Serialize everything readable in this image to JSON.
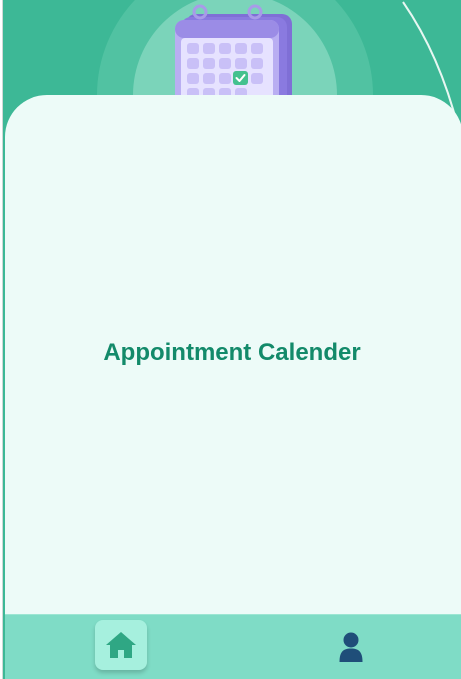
{
  "screen": {
    "title": "Appointment Calender"
  },
  "header": {
    "illustration": "calendar-illustration"
  },
  "bottom_nav": {
    "items": [
      {
        "name": "home",
        "icon": "home-icon",
        "active": true
      },
      {
        "name": "profile",
        "icon": "user-icon",
        "active": false
      }
    ]
  },
  "colors": {
    "primary_green": "#3db896",
    "card_background": "#edfbf8",
    "title_text": "#138a6a",
    "nav_background": "#7fdcc6",
    "nav_active": "#a6f0de",
    "home_icon": "#2fa784",
    "user_icon": "#1f4e79",
    "calendar_purple": "#9b8ce6"
  }
}
